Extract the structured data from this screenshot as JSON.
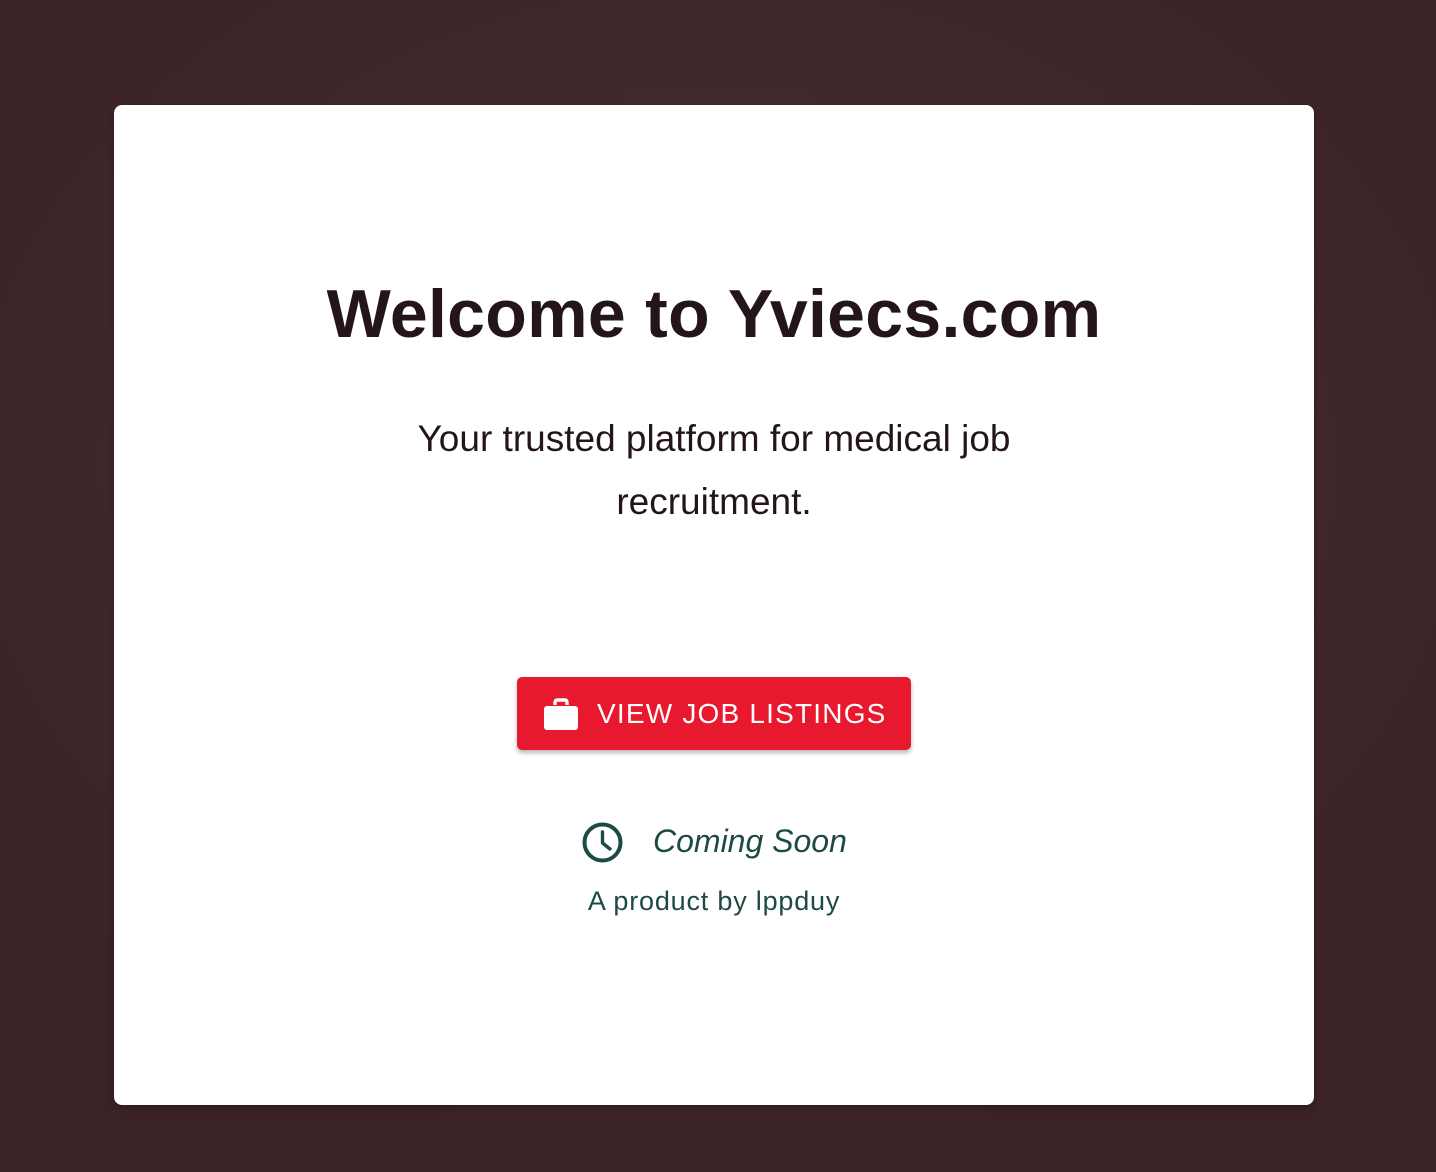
{
  "hero": {
    "title": "Welcome to Yviecs.com",
    "tagline": "Your trusted platform for medical job recruitment."
  },
  "cta": {
    "label": "VIEW JOB LISTINGS",
    "icon": "briefcase-icon"
  },
  "status": {
    "text": "Coming Soon",
    "icon": "clock-icon"
  },
  "footer": {
    "byline": "A product by lppduy"
  },
  "colors": {
    "background": "#432a2e",
    "card": "#ffffff",
    "title_text": "#241518",
    "cta_background": "#e8192f",
    "cta_text": "#ffffff",
    "status_text": "#1d4a44"
  }
}
